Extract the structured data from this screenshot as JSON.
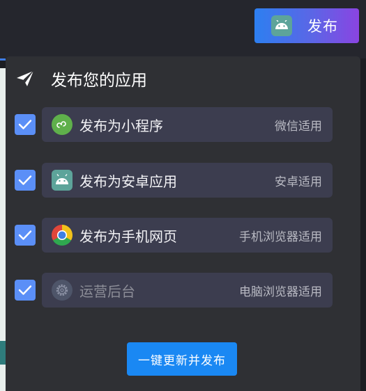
{
  "header": {
    "publish_button": {
      "label": "发布",
      "icon": "android-icon"
    }
  },
  "panel": {
    "title": "发布您的应用",
    "title_icon": "paper-plane-icon",
    "options": [
      {
        "name": "发布为小程序",
        "hint": "微信适用",
        "icon": "mini-program-icon",
        "checked": true,
        "enabled": true
      },
      {
        "name": "发布为安卓应用",
        "hint": "安卓适用",
        "icon": "android-icon",
        "checked": true,
        "enabled": true
      },
      {
        "name": "发布为手机网页",
        "hint": "手机浏览器适用",
        "icon": "chrome-icon",
        "checked": true,
        "enabled": true
      },
      {
        "name": "运营后台",
        "hint": "电脑浏览器适用",
        "icon": "gear-icon",
        "checked": true,
        "enabled": false
      }
    ],
    "update_button": {
      "label": "一键更新并发布"
    }
  },
  "colors": {
    "accent_blue": "#1a88f3",
    "checkbox": "#5b8ff7",
    "panel_bg": "#2f3034",
    "option_bg": "#3c3d4f"
  }
}
